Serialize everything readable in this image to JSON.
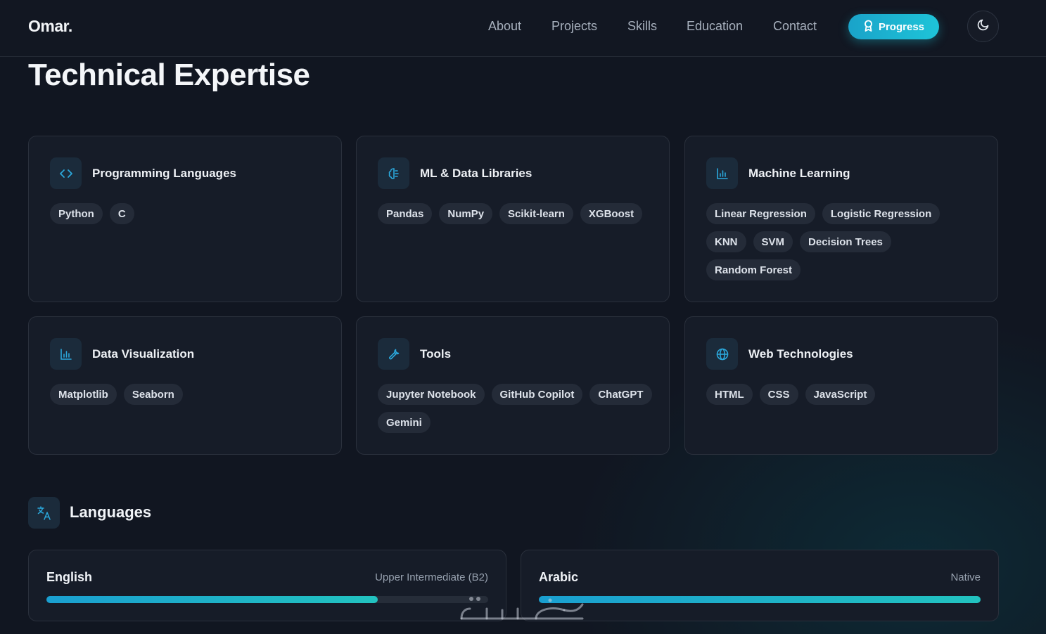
{
  "header": {
    "logo": "Omar.",
    "nav": [
      "About",
      "Projects",
      "Skills",
      "Education",
      "Contact"
    ],
    "progress_label": "Progress"
  },
  "skills": {
    "title": "Technical Expertise",
    "cards": [
      {
        "title": "Programming Languages",
        "icon": "code-icon",
        "tags": [
          "Python",
          "C"
        ]
      },
      {
        "title": "ML & Data Libraries",
        "icon": "brain-icon",
        "tags": [
          "Pandas",
          "NumPy",
          "Scikit-learn",
          "XGBoost"
        ]
      },
      {
        "title": "Machine Learning",
        "icon": "bar-chart-icon",
        "tags": [
          "Linear Regression",
          "Logistic Regression",
          "KNN",
          "SVM",
          "Decision Trees",
          "Random Forest"
        ]
      },
      {
        "title": "Data Visualization",
        "icon": "bar-chart-icon",
        "tags": [
          "Matplotlib",
          "Seaborn"
        ]
      },
      {
        "title": "Tools",
        "icon": "wrench-icon",
        "tags": [
          "Jupyter Notebook",
          "GitHub Copilot",
          "ChatGPT",
          "Gemini"
        ]
      },
      {
        "title": "Web Technologies",
        "icon": "globe-icon",
        "tags": [
          "HTML",
          "CSS",
          "JavaScript"
        ]
      }
    ]
  },
  "languages": {
    "title": "Languages",
    "items": [
      {
        "name": "English",
        "level": "Upper Intermediate (B2)",
        "progress": 0.75
      },
      {
        "name": "Arabic",
        "level": "Native",
        "progress": 1.0
      }
    ]
  },
  "colors": {
    "accent": "#1ec4d8",
    "background": "#111621",
    "card": "#161c28",
    "tag": "#242b38"
  }
}
